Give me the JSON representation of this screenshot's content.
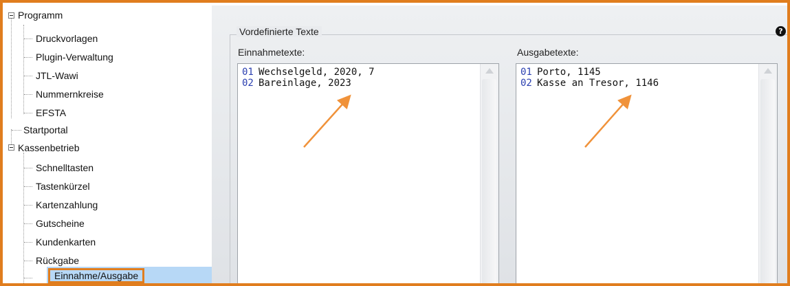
{
  "tree": {
    "items": [
      {
        "label": "Programm",
        "level": 0,
        "expanded": true
      },
      {
        "label": "Druckvorlagen",
        "level": 1
      },
      {
        "label": "Plugin-Verwaltung",
        "level": 1
      },
      {
        "label": "JTL-Wawi",
        "level": 1
      },
      {
        "label": "Nummernkreise",
        "level": 1
      },
      {
        "label": "EFSTA",
        "level": 1
      },
      {
        "label": "Startportal",
        "level": 0
      },
      {
        "label": "Kassenbetrieb",
        "level": 0,
        "expanded": true
      },
      {
        "label": "Schnelltasten",
        "level": 1
      },
      {
        "label": "Tastenkürzel",
        "level": 1
      },
      {
        "label": "Kartenzahlung",
        "level": 1
      },
      {
        "label": "Gutscheine",
        "level": 1
      },
      {
        "label": "Kundenkarten",
        "level": 1
      },
      {
        "label": "Rückgabe",
        "level": 1
      },
      {
        "label": "Einnahme/Ausgabe",
        "level": 1,
        "selected": true
      }
    ]
  },
  "panel": {
    "group_title": "Vordefinierte Texte",
    "help_icon": "?",
    "income": {
      "label": "Einnahmetexte:",
      "lines": [
        {
          "num": "01",
          "text": "Wechselgeld, 2020, 7"
        },
        {
          "num": "02",
          "text": "Bareinlage, 2023"
        }
      ]
    },
    "expense": {
      "label": "Ausgabetexte:",
      "lines": [
        {
          "num": "01",
          "text": "Porto, 1145"
        },
        {
          "num": "02",
          "text": "Kasse an Tresor, 1146"
        }
      ]
    }
  },
  "colors": {
    "accent": "#e07d1e",
    "selection": "#b7d8f6",
    "line_number": "#2a3fb0"
  }
}
